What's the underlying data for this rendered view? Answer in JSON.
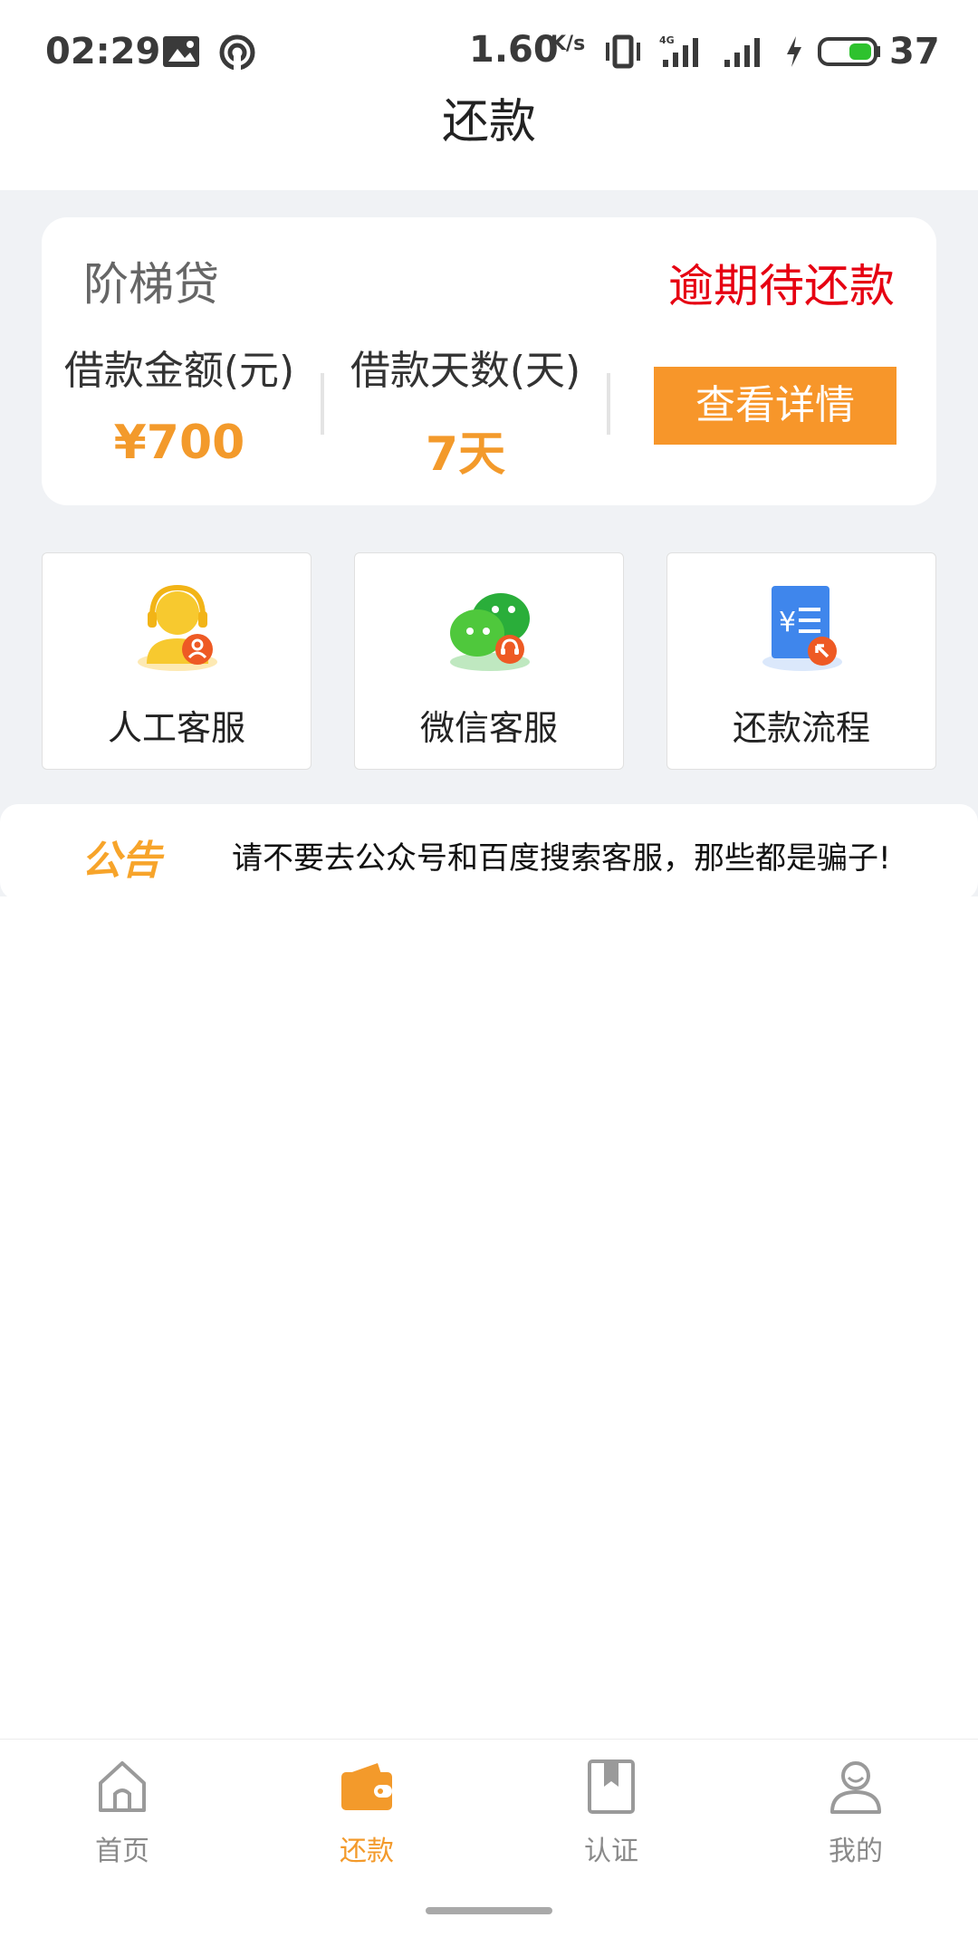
{
  "status_bar": {
    "time": "02:29",
    "speed": "1.60",
    "speed_unit": "K/s",
    "battery": "37"
  },
  "header": {
    "title": "还款"
  },
  "loan_card": {
    "product_name": "阶梯贷",
    "status": "逾期待还款",
    "amount_label": "借款金额(元)",
    "amount_value": "¥700",
    "days_label": "借款天数(天)",
    "days_value": "7天",
    "detail_button": "查看详情"
  },
  "services": [
    {
      "label": "人工客服",
      "icon": "customer-service-icon"
    },
    {
      "label": "微信客服",
      "icon": "wechat-service-icon"
    },
    {
      "label": "还款流程",
      "icon": "repayment-process-icon"
    }
  ],
  "notice": {
    "tag": "公告",
    "text": "请不要去公众号和百度搜索客服，那些都是骗子!"
  },
  "bottom_nav": [
    {
      "label": "首页",
      "icon": "home-icon",
      "active": false
    },
    {
      "label": "还款",
      "icon": "wallet-icon",
      "active": true
    },
    {
      "label": "认证",
      "icon": "bookmark-icon",
      "active": false
    },
    {
      "label": "我的",
      "icon": "user-icon",
      "active": false
    }
  ],
  "colors": {
    "accent": "#f39a2b",
    "button": "#f7962a",
    "overdue": "#e60012",
    "background": "#f0f2f5"
  }
}
